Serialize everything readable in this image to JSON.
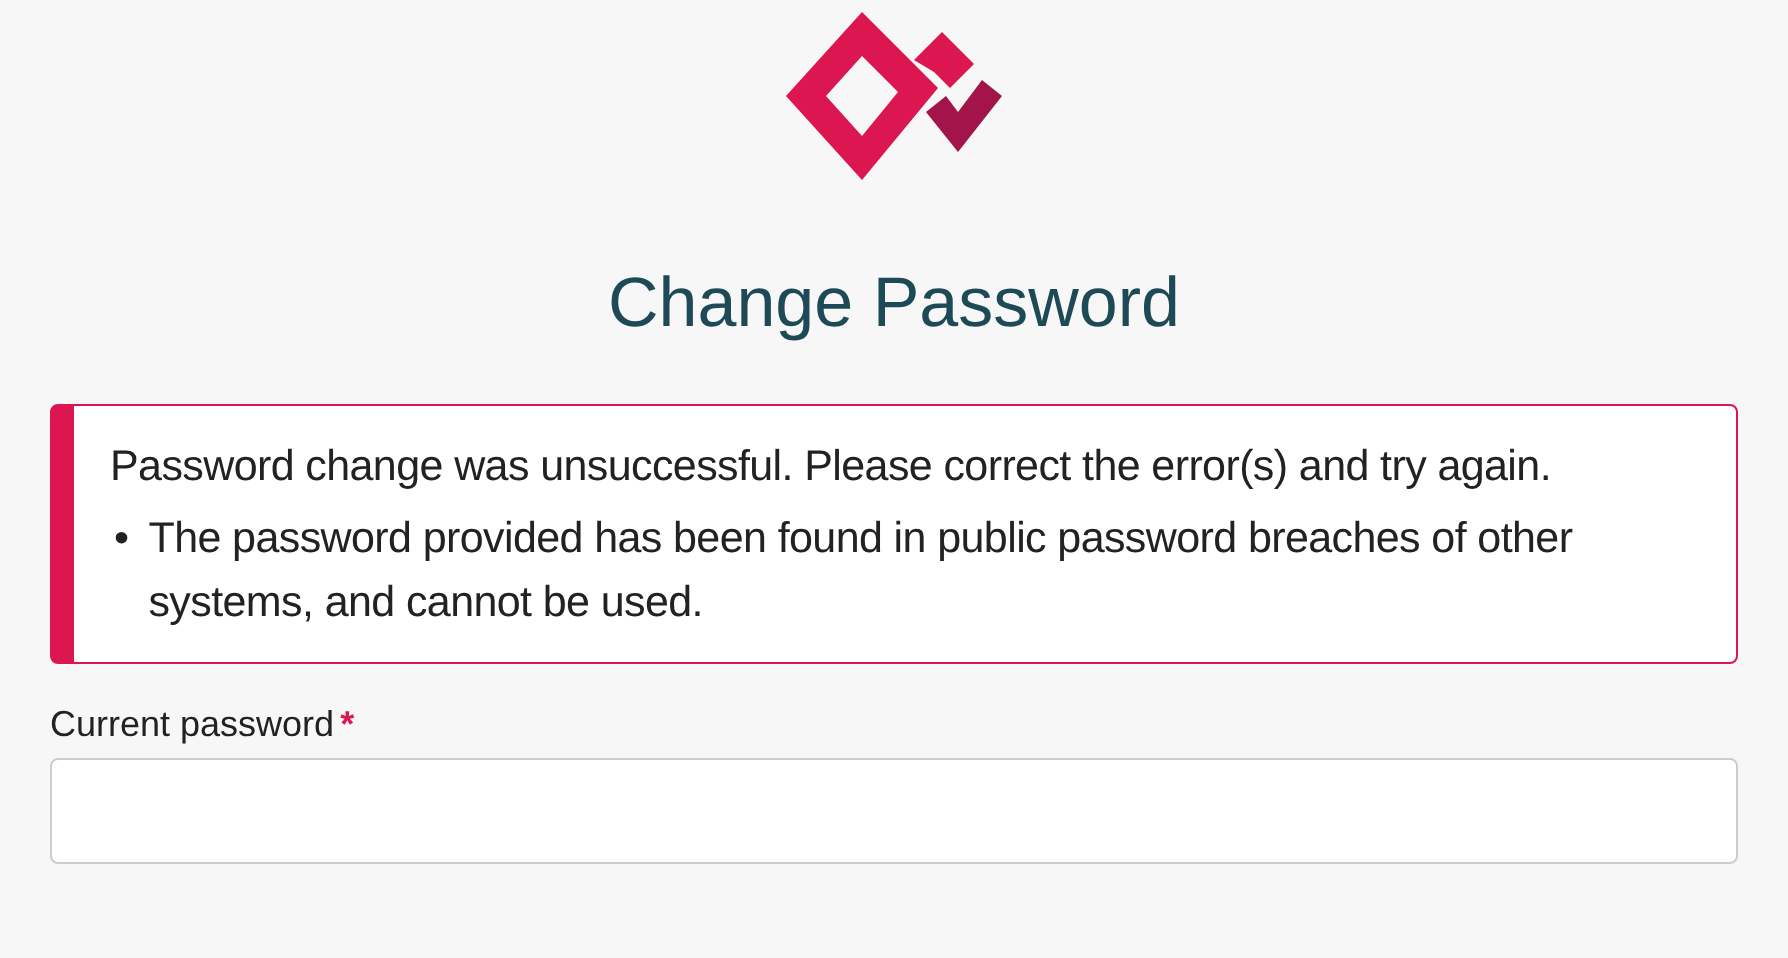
{
  "page": {
    "title": "Change Password"
  },
  "alert": {
    "kind": "error",
    "message": "Password change was unsuccessful. Please correct the error(s) and try again.",
    "errors": [
      {
        "bullet": "•",
        "text": "The password provided has been found in public password breaches of other systems, and cannot be used."
      }
    ]
  },
  "fields": [
    {
      "label": "Current password",
      "required_mark": "*"
    }
  ]
}
